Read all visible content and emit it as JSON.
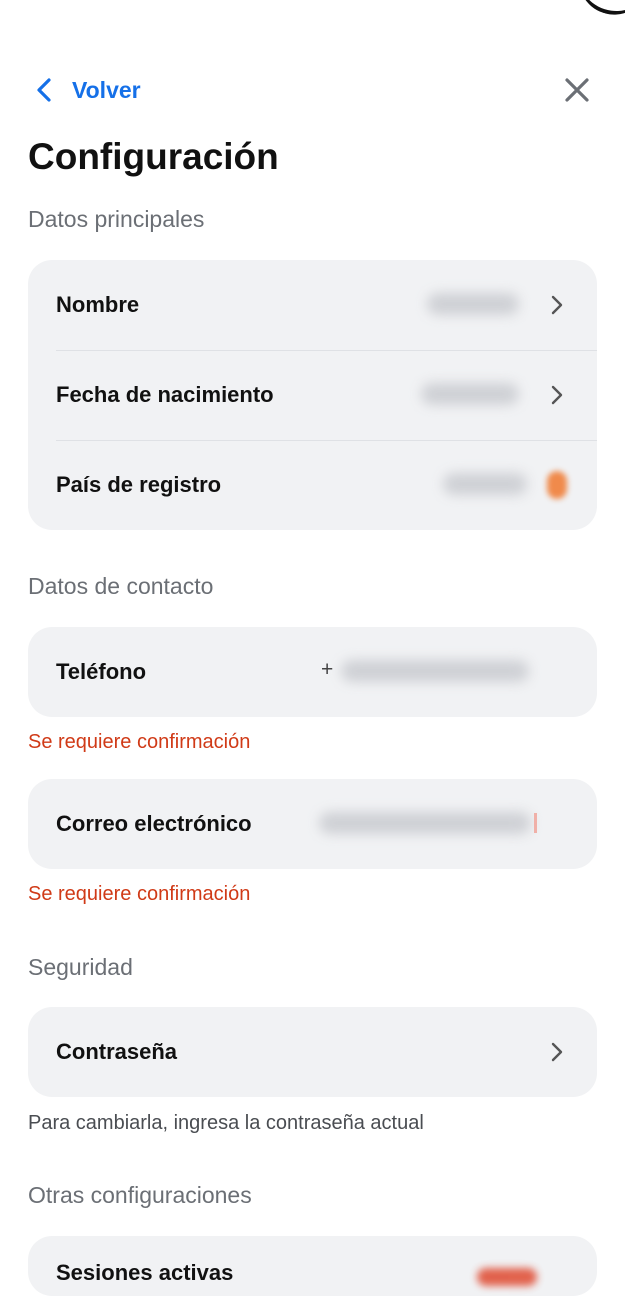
{
  "header": {
    "back_label": "Volver",
    "title": "Configuración"
  },
  "sections": {
    "principal": {
      "label": "Datos principales",
      "rows": [
        {
          "label": "Nombre"
        },
        {
          "label": "Fecha de nacimiento"
        },
        {
          "label": "País de registro"
        }
      ]
    },
    "contact": {
      "label": "Datos de contacto",
      "phone": {
        "label": "Teléfono",
        "prefix": "+",
        "error": "Se requiere confirmación"
      },
      "email": {
        "label": "Correo electrónico",
        "error": "Se requiere confirmación"
      }
    },
    "security": {
      "label": "Seguridad",
      "password": {
        "label": "Contraseña"
      },
      "hint": "Para cambiarla, ingresa la contraseña actual"
    },
    "other": {
      "label": "Otras configuraciones",
      "sessions": {
        "label": "Sesiones activas"
      }
    }
  },
  "colors": {
    "accent": "#1570e8",
    "error": "#d03a17",
    "card": "#f1f2f4",
    "muted": "#6b6f75"
  },
  "icons": [
    "chevron-left-icon",
    "close-icon",
    "chevron-right-icon",
    "flag-icon"
  ]
}
